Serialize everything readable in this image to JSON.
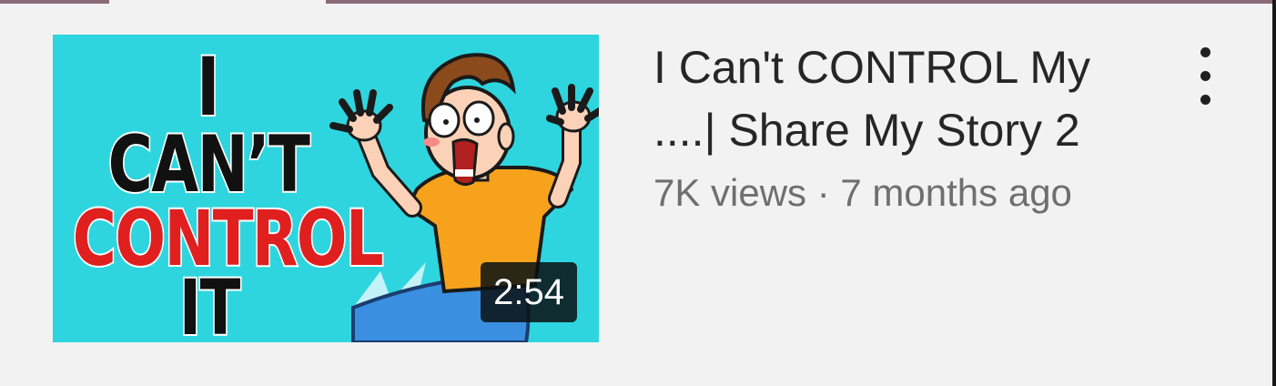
{
  "video": {
    "thumbnail_text": [
      "I",
      "CAN’T",
      "CONTROL",
      "IT"
    ],
    "duration": "2:54",
    "title": "I Can't CONTROL My ....| Share My Story 2",
    "views": "7K views",
    "separator": "·",
    "age": "7 months ago"
  },
  "icons": {
    "more": "more-vert-icon"
  },
  "colors": {
    "background": "#f2f2f2",
    "thumbnail_background": "#2fd5de",
    "thumbnail_accent_red": "#e01f1f",
    "title": "#262626",
    "meta": "#6f6f6f"
  }
}
